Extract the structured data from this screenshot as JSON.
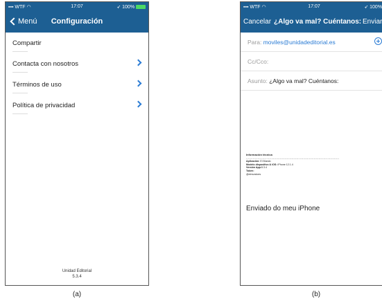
{
  "colors": {
    "bar": "#1d5f93",
    "link": "#2a7bd4",
    "battery": "#4cd964"
  },
  "status_bar": {
    "carrier": "WTF",
    "time": "17:07",
    "battery": "100%"
  },
  "settings_screen": {
    "back_label": "Menú",
    "title": "Configuración",
    "items": [
      {
        "label": "Compartir",
        "chevron": false
      },
      {
        "label": "Contacta con nosotros",
        "chevron": true
      },
      {
        "label": "Términos de uso",
        "chevron": true
      },
      {
        "label": "Política de privacidad",
        "chevron": true
      }
    ],
    "footer": {
      "company": "Unidad Editorial",
      "version": "5.3.4"
    },
    "caption": "(a)"
  },
  "mail_screen": {
    "cancel_label": "Cancelar",
    "subject_title": "¿Algo va mal? Cuéntanos:",
    "send_label": "Enviar",
    "to_label": "Para:",
    "to_value": "moviles@unidadeditorial.es",
    "cc_label": "Cc/Cco:",
    "subject_label": "Asunto:",
    "subject_value": "¿Algo va mal? Cuéntanos:",
    "tech_info": {
      "title": "Información técnica",
      "dashes": "------------------------------------------------------------------------------------------------",
      "app_label": "Aplicación:",
      "app_value": "El Mundo",
      "model_label": "Modelo dispositivo & iOS:",
      "model_value": "iPhone 12.1.4",
      "version_label": "Versión App:",
      "version_value": "5.3.4",
      "token_label": "Token:",
      "token_value": "@elmundoes"
    },
    "signature": "Enviado do meu iPhone",
    "caption": "(b)"
  }
}
